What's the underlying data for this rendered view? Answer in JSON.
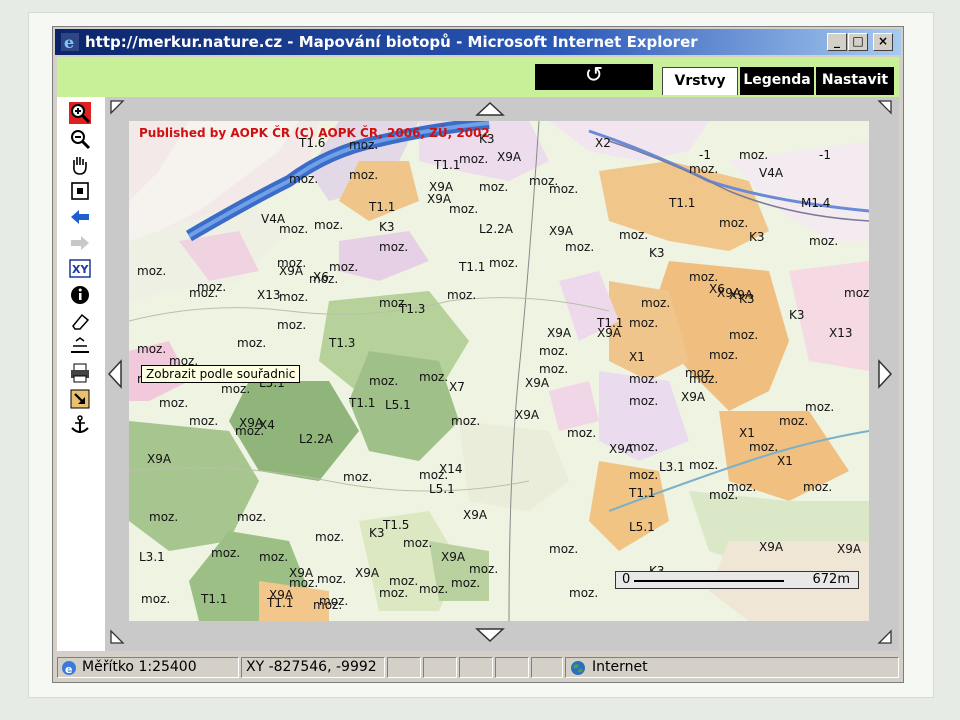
{
  "window": {
    "title": "http://merkur.nature.cz - Mapování biotopů - Microsoft Internet Explorer",
    "controls": {
      "minimize": "_",
      "maximize": "□",
      "close": "×"
    }
  },
  "topbar": {
    "refresh_icon": "↺",
    "tabs": [
      {
        "label": "Vrstvy",
        "active": true
      },
      {
        "label": "Legenda",
        "active": false
      },
      {
        "label": "Nastavit",
        "active": false
      }
    ]
  },
  "toolbar": {
    "tools": [
      "zoom-in-icon",
      "zoom-out-icon",
      "pan-hand-icon",
      "full-extent-icon",
      "back-arrow-icon",
      "forward-arrow-icon",
      "xy-coordinates-icon",
      "info-icon",
      "eraser-icon",
      "measure-icon",
      "print-icon",
      "export-icon",
      "anchor-icon"
    ],
    "xy_label": "XY",
    "tooltip": "Zobrazit podle souřadnic"
  },
  "map": {
    "copyright": "Published by AOPK ČR    (C) AOPK ČR, 2006, ZÚ, 2002",
    "scale_start": "0",
    "scale_end": "672m",
    "labels": [
      "T1.6",
      "moz.",
      "K3",
      "X9A",
      "X2",
      "moz.",
      "-1",
      "moz.",
      "-1",
      "moz.",
      "T1.1",
      "moz.",
      "V4A",
      "moz.",
      "X9A",
      "moz.",
      "moz.",
      "M1.4",
      "T1.1",
      "X9A",
      "moz.",
      "T1.1",
      "moz.",
      "V4A",
      "moz.",
      "K3",
      "moz.",
      "moz.",
      "L2.2A",
      "X9A",
      "moz.",
      "moz.",
      "moz.",
      "moz.",
      "moz.",
      "X6",
      "moz.",
      "K3",
      "T1.1",
      "moz.",
      "X9A",
      "moz.",
      "moz.",
      "moz.",
      "K3",
      "X9A",
      "moz.",
      "moz.",
      "X6",
      "K3",
      "moz.",
      "X13",
      "moz.",
      "moz.",
      "T1.3",
      "moz.",
      "X9A",
      "moz.",
      "K3",
      "moz.",
      "X9A",
      "X9A",
      "moz.",
      "T1.1",
      "moz.",
      "X13",
      "moz.",
      "moz.",
      "moz.",
      "T1.3",
      "moz.",
      "moz.",
      "X1",
      "moz.",
      "moz.",
      "moz.",
      "X9A",
      "moz.",
      "moz.",
      "moz.",
      "L5.1",
      "moz.",
      "L5.1",
      "moz.",
      "moz.",
      "X7",
      "T1.1",
      "moz.",
      "X9A",
      "moz.",
      "X9A",
      "moz.",
      "X9A",
      "moz.",
      "moz.",
      "moz.",
      "X1",
      "L2.2A",
      "X9A",
      "moz.",
      "moz.",
      "X9A",
      "X4",
      "X14",
      "moz.",
      "moz.",
      "L3.1",
      "moz.",
      "X1",
      "moz.",
      "L5.1",
      "moz.",
      "moz.",
      "moz.",
      "T1.1",
      "moz.",
      "moz.",
      "moz.",
      "T1.5",
      "X9A",
      "moz.",
      "K3",
      "L5.1",
      "X9A",
      "X9A",
      "X9A",
      "L3.1",
      "moz.",
      "moz.",
      "moz.",
      "moz.",
      "X9A",
      "moz.",
      "X9A",
      "moz.",
      "K3",
      "moz.",
      "X9A",
      "moz.",
      "moz.",
      "moz.",
      "T1.1",
      "moz.",
      "T1.1",
      "moz.",
      "moz.",
      "moz.",
      "moz."
    ]
  },
  "statusbar": {
    "scale": "Měřítko 1:25400",
    "xy": "XY -827546, -9992",
    "zone": "Internet"
  }
}
